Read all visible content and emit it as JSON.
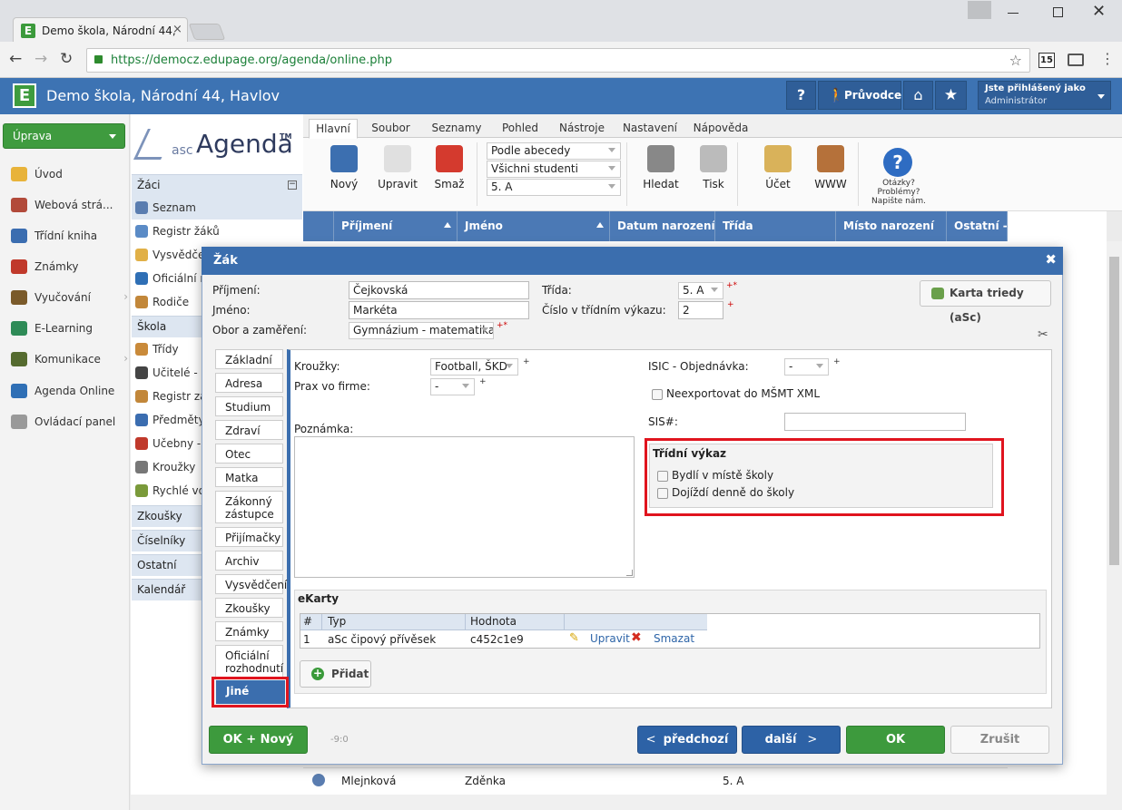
{
  "browser": {
    "tab_title": "Demo škola, Národní 44,",
    "url": "https://democz.edupage.org/agenda/online.php",
    "ext_badge": "15"
  },
  "app": {
    "title": "Demo škola, Národní 44, Havlov",
    "guide_label": "Průvodce",
    "help_label": "?",
    "logged_as_label": "Jste přihlášený jako",
    "logged_user": "Administrátor"
  },
  "leftnav": {
    "dropdown": "Úprava",
    "items": [
      {
        "label": "Úvod",
        "color": "#e8b33a"
      },
      {
        "label": "Webová strá...",
        "color": "#b24a3a"
      },
      {
        "label": "Třídní kniha",
        "color": "#3b6db0"
      },
      {
        "label": "Známky",
        "color": "#c0392b"
      },
      {
        "label": "Vyučování",
        "color": "#7a5a2a"
      },
      {
        "label": "E-Learning",
        "color": "#2e8b57"
      },
      {
        "label": "Komunikace",
        "color": "#556b2f"
      },
      {
        "label": "Agenda Online",
        "color": "#2f6fb5"
      },
      {
        "label": "Ovládací panel",
        "color": "#999999"
      }
    ]
  },
  "agenda": {
    "logo_prefix": "asc",
    "logo_text": "Agenda",
    "logo_tm": "TM",
    "sec_zaci": "Žáci",
    "zaci_items": [
      "Seznam",
      "Registr žáků",
      "Vysvědče",
      "Oficiální ro",
      "Rodiče"
    ],
    "sec_skola": "Škola",
    "skola_items": [
      "Třídy",
      "Učitelé - z",
      "Registr za",
      "Předměty",
      "Učebny - ",
      "Kroužky",
      "Rychlé vo"
    ],
    "other_sections": [
      "Zkoušky",
      "Číselníky",
      "Ostatní",
      "Kalendář"
    ]
  },
  "ribbon": {
    "tabs": [
      "Hlavní",
      "Soubor",
      "Seznamy",
      "Pohled",
      "Nástroje",
      "Nastavení",
      "Nápověda"
    ],
    "buttons": [
      "Nový",
      "Upravit",
      "Smaž"
    ],
    "selects": [
      "Podle abecedy",
      "Všichni studenti",
      "5. A"
    ],
    "buttons2": [
      "Hledat",
      "Tisk",
      "Účet",
      "WWW"
    ],
    "help_text": [
      "Otázky?",
      "Problémy?",
      "Napište nám."
    ]
  },
  "grid": {
    "columns": [
      "Příjmení",
      "Jméno",
      "Datum narození",
      "Třída",
      "Místo narození",
      "Ostatní - I"
    ],
    "row": {
      "surname": "Mlejnková",
      "name": "Zděnka",
      "class": "5. A"
    }
  },
  "dialog": {
    "title": "Žák",
    "labels": {
      "surname": "Příjmení:",
      "name": "Jméno:",
      "field": "Obor a zaměření:",
      "class": "Třída:",
      "class_no": "Číslo v třídním výkazu:"
    },
    "values": {
      "surname": "Čejkovská",
      "name": "Markéta",
      "field": "Gymnázium - matematika",
      "class": "5. A",
      "class_no": "2"
    },
    "required_mark": "*",
    "plus_mark": "+",
    "card_button": "Karta triedy (aSc)",
    "tabs": [
      "Základní",
      "Adresa",
      "Studium",
      "Zdraví",
      "Otec",
      "Matka",
      "Zákonný zástupce",
      "Přijímačky",
      "Archiv",
      "Vysvědčení",
      "Zkoušky",
      "Známky",
      "Oficiální rozhodnutí",
      "Jiné"
    ],
    "panel": {
      "clubs_label": "Kroužky:",
      "clubs_value": "Football, ŠKD",
      "prax_label": "Prax vo firme:",
      "prax_value": "-",
      "isic_label": "ISIC - Objednávka:",
      "isic_value": "-",
      "no_export_label": "Neexportovat do MŠMT XML",
      "sis_label": "SIS#:",
      "note_label": "Poznámka:",
      "tv_title": "Třídní výkaz",
      "tv_opt1": "Bydlí v místě školy",
      "tv_opt2": "Dojíždí denně do školy",
      "ekarty_title": "eKarty",
      "ekarty_cols": [
        "#",
        "Typ",
        "Hodnota"
      ],
      "ekarty_row": {
        "no": "1",
        "type": "aSc čipový přívěsek",
        "value": "c452c1e9",
        "edit": "Upravit",
        "delete": "Smazat"
      },
      "add_button": "Přidat"
    },
    "footer": {
      "ok_new": "OK + Nový",
      "hint": "-9:0",
      "prev": "předchozí",
      "next": "další",
      "ok": "OK",
      "cancel": "Zrušit"
    }
  },
  "colors": {
    "app_header": "#3d73b3",
    "grid_header": "#4b79b5",
    "dialog_title": "#3b6eae",
    "green_btn": "#3d9a3d",
    "blue_btn": "#2d62a6",
    "highlight": "#e0141e"
  }
}
